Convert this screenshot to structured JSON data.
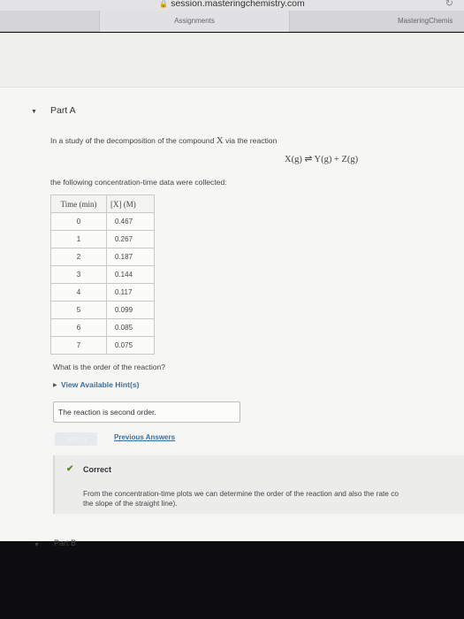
{
  "browser": {
    "url": "session.masteringchemistry.com",
    "lock_icon": "lock-icon",
    "reload_icon": "reload-icon"
  },
  "tabs": [
    {
      "label": "Assignments"
    },
    {
      "label": "MasteringChemis"
    }
  ],
  "part_a": {
    "title": "Part A",
    "intro": "In a study of the decomposition of the compound ",
    "compound": "X",
    "intro_end": " via the reaction",
    "reaction": "X(g) ⇌ Y(g) + Z(g)",
    "collected": "the following concentration-time data were collected:",
    "table": {
      "col1_header": "Time (min)",
      "col2_header": "[X] (M)",
      "rows": [
        {
          "time": "0",
          "conc": "0.467"
        },
        {
          "time": "1",
          "conc": "0.267"
        },
        {
          "time": "2",
          "conc": "0.187"
        },
        {
          "time": "3",
          "conc": "0.144"
        },
        {
          "time": "4",
          "conc": "0.117"
        },
        {
          "time": "5",
          "conc": "0.099"
        },
        {
          "time": "6",
          "conc": "0.085"
        },
        {
          "time": "7",
          "conc": "0.075"
        }
      ]
    },
    "question": "What is the order of the reaction?",
    "hint_link": "View Available Hint(s)",
    "answer": "The reaction is second order.",
    "submit_label": "Submit",
    "previous_answers": "Previous Answers",
    "feedback": {
      "status": "Correct",
      "line1": "From the concentration-time plots we can determine the order of the reaction and also the rate co",
      "line2": "the slope of the straight line)."
    }
  },
  "part_b": {
    "title": "Part B"
  },
  "colors": {
    "link": "#3b6f9a",
    "correct_check": "#5a8a2f"
  }
}
